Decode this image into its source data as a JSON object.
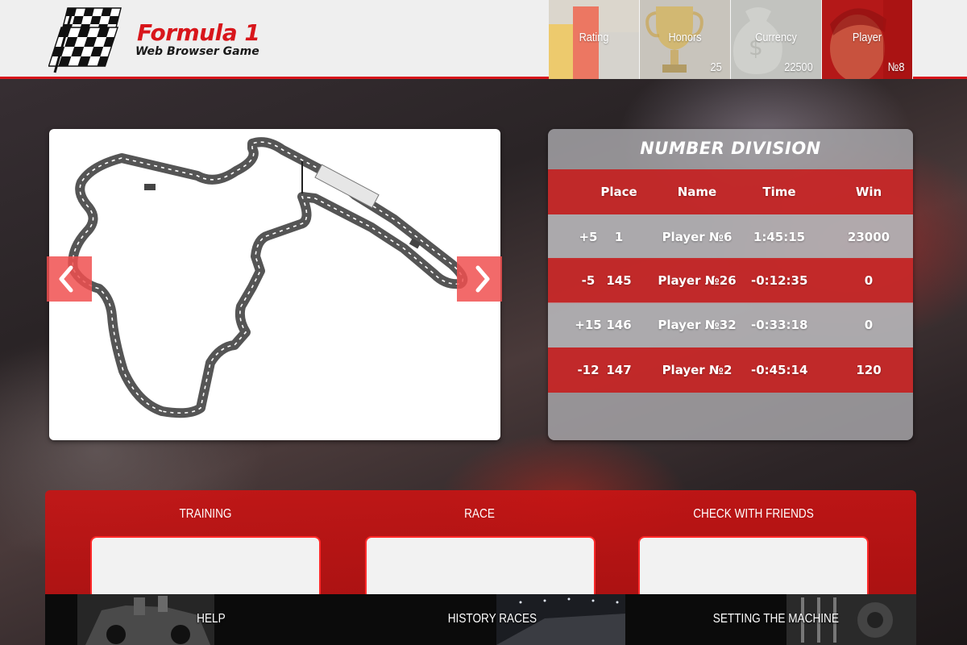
{
  "logo": {
    "title": "Formula 1",
    "subtitle": "Web Browser Game"
  },
  "stats": [
    {
      "label": "Rating",
      "value": ""
    },
    {
      "label": "Honors",
      "value": "25"
    },
    {
      "label": "Currency",
      "value": "22500"
    },
    {
      "label": "Player",
      "value": "№8"
    }
  ],
  "division": {
    "title": "NUMBER DIVISION",
    "headers": {
      "place": "Place",
      "name": "Name",
      "time": "Time",
      "win": "Win"
    },
    "rows": [
      {
        "delta": "+5",
        "place": "1",
        "name": "Player №6",
        "time": "1:45:15",
        "win": "23000"
      },
      {
        "delta": "-5",
        "place": "145",
        "name": "Player №26",
        "time": "-0:12:35",
        "win": "0"
      },
      {
        "delta": "+15",
        "place": "146",
        "name": "Player №32",
        "time": "-0:33:18",
        "win": "0"
      },
      {
        "delta": "-12",
        "place": "147",
        "name": "Player №2",
        "time": "-0:45:14",
        "win": "120"
      }
    ]
  },
  "modes": {
    "training": "TRAINING",
    "race": "RACE",
    "friends": "CHECK WITH FRIENDS"
  },
  "bottom": {
    "help": "HELP",
    "history": "HISTORY RACES",
    "setting": "SETTING THE MACHINE"
  },
  "icons": {
    "logo": "checkered-flag-icon",
    "prev": "chevron-left-icon",
    "next": "chevron-right-icon"
  },
  "colors": {
    "accent": "#d8161b",
    "header_bg": "#efefef",
    "card_border": "#ff2a2a"
  }
}
